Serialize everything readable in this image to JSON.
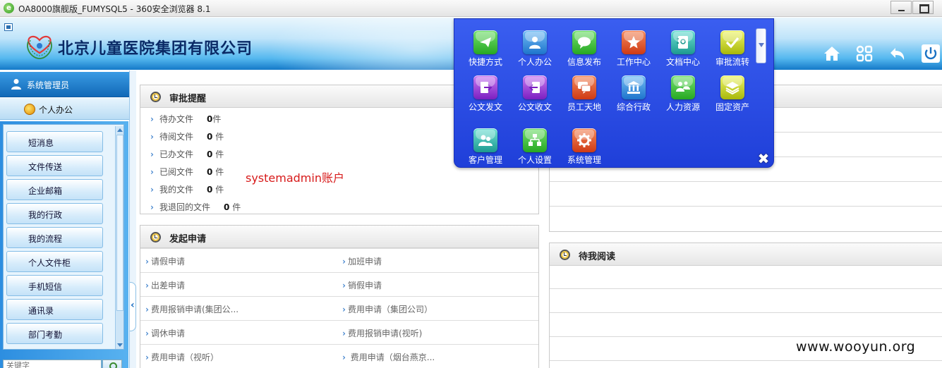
{
  "browser": {
    "title": "OA8000旗舰版_FUMYSQL5 - 360安全浏览器 8.1"
  },
  "header": {
    "company": "北京儿童医院集团有限公司"
  },
  "sidebar": {
    "user": "系统管理员",
    "section": "个人办公",
    "items": [
      "短消息",
      "文件传送",
      "企业邮箱",
      "我的行政",
      "我的流程",
      "个人文件柜",
      "手机短信",
      "通讯录",
      "部门考勤"
    ],
    "search_placeholder": "关键字"
  },
  "approval": {
    "title": "审批提醒",
    "rows": [
      {
        "label": "待办文件",
        "count": "0",
        "unit": "件"
      },
      {
        "label": "待阅文件",
        "count": "0",
        "unit": "件"
      },
      {
        "label": "已办文件",
        "count": "0",
        "unit": "件"
      },
      {
        "label": "已阅文件",
        "count": "0",
        "unit": "件"
      },
      {
        "label": "我的文件",
        "count": "0",
        "unit": "件"
      },
      {
        "label": "我退回的文件",
        "count": "0",
        "unit": "件"
      }
    ]
  },
  "apply": {
    "title": "发起申请",
    "items": [
      [
        "请假申请",
        "加班申请"
      ],
      [
        "出差申请",
        "销假申请"
      ],
      [
        "费用报销申请(集团公...",
        "费用申请（集团公司）"
      ],
      [
        "调休申请",
        "费用报销申请(视听)"
      ],
      [
        "费用申请（视听）",
        "费用申请（烟台燕京..."
      ]
    ]
  },
  "to_read": {
    "title": "待我阅读"
  },
  "annotation": "systemadmin账户",
  "watermark": "www.wooyun.org",
  "popup": {
    "items": [
      {
        "label": "快捷方式",
        "icon": "paper-plane-icon",
        "color": "#3cc43a"
      },
      {
        "label": "个人办公",
        "icon": "person-icon",
        "color": "#2e8fe0"
      },
      {
        "label": "信息发布",
        "icon": "speech-bubble-icon",
        "color": "#3cc43a"
      },
      {
        "label": "工作中心",
        "icon": "star-icon",
        "color": "#e0501f"
      },
      {
        "label": "文档中心",
        "icon": "address-book-icon",
        "color": "#2fb3a8"
      },
      {
        "label": "审批流转",
        "icon": "checkmark-icon",
        "color": "#c6d80f"
      },
      {
        "label": "公文发文",
        "icon": "document-export-icon",
        "color": "#9a2fd8"
      },
      {
        "label": "公文收文",
        "icon": "document-import-icon",
        "color": "#9a2fd8"
      },
      {
        "label": "员工天地",
        "icon": "chat-icon",
        "color": "#e05a22"
      },
      {
        "label": "综合行政",
        "icon": "bank-icon",
        "color": "#2e8fe0"
      },
      {
        "label": "人力资源",
        "icon": "people-icon",
        "color": "#3cc43a"
      },
      {
        "label": "固定资产",
        "icon": "layers-icon",
        "color": "#c6d80f"
      },
      {
        "label": "客户管理",
        "icon": "users-icon",
        "color": "#2fb3a8"
      },
      {
        "label": "个人设置",
        "icon": "org-chart-icon",
        "color": "#3cc43a"
      },
      {
        "label": "系统管理",
        "icon": "gear-icon",
        "color": "#e05a22"
      }
    ]
  }
}
